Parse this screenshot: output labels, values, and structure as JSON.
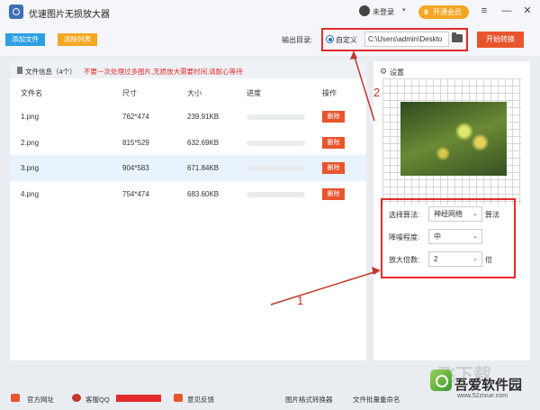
{
  "app": {
    "title": "优速图片无损放大器"
  },
  "titlebar": {
    "login": "未登录",
    "vip": "开通会员",
    "menu_glyph": "≡",
    "minimize_glyph": "—",
    "close_glyph": "✕"
  },
  "toolbar": {
    "add_file": "添加文件",
    "clear_list": "清除列表",
    "output_label": "输出目录:",
    "custom_option": "自定义",
    "output_path": "C:\\Users\\admin\\Deskto",
    "start_button": "开始转换"
  },
  "file_list": {
    "info_label": "文件信息（4个）",
    "warning": "不要一次处理过多图片,无损放大需要时间,请耐心等待",
    "headers": [
      "文件名",
      "尺寸",
      "大小",
      "进度",
      "操作"
    ],
    "delete_label": "删除",
    "rows": [
      {
        "name": "1.png",
        "size": "762*474",
        "filesize": "239.91KB",
        "progress": 0
      },
      {
        "name": "2.png",
        "size": "815*529",
        "filesize": "632.69KB",
        "progress": 0
      },
      {
        "name": "3.png",
        "size": "904*583",
        "filesize": "671.84KB",
        "progress": 0,
        "selected": true
      },
      {
        "name": "4.png",
        "size": "754*474",
        "filesize": "683.60KB",
        "progress": 0
      }
    ]
  },
  "settings": {
    "title": "设置",
    "algorithm_label": "选择算法:",
    "algorithm_value": "神经网络",
    "algorithm_suffix": "算法",
    "denoise_label": "降噪程度:",
    "denoise_value": "中",
    "scale_label": "放大倍数:",
    "scale_value": "2",
    "scale_suffix": "倍"
  },
  "annotations": {
    "arrow1_label": "1",
    "arrow2_label": "2",
    "color": "#c0392b"
  },
  "footer": {
    "website": "官方网址",
    "support_qq": "客服QQ",
    "feedback": "意见反馈",
    "format_converter": "图片格式转换器",
    "batch_rename": "文件批量重命名"
  },
  "watermark": {
    "brand": "吾爱软件园",
    "big": "飞下载",
    "url": "www.52zixue.com"
  },
  "colors": {
    "blue": "#2d9fe3",
    "orange": "#f5a623",
    "red": "#e8552c",
    "annotation": "#e32b2b"
  }
}
